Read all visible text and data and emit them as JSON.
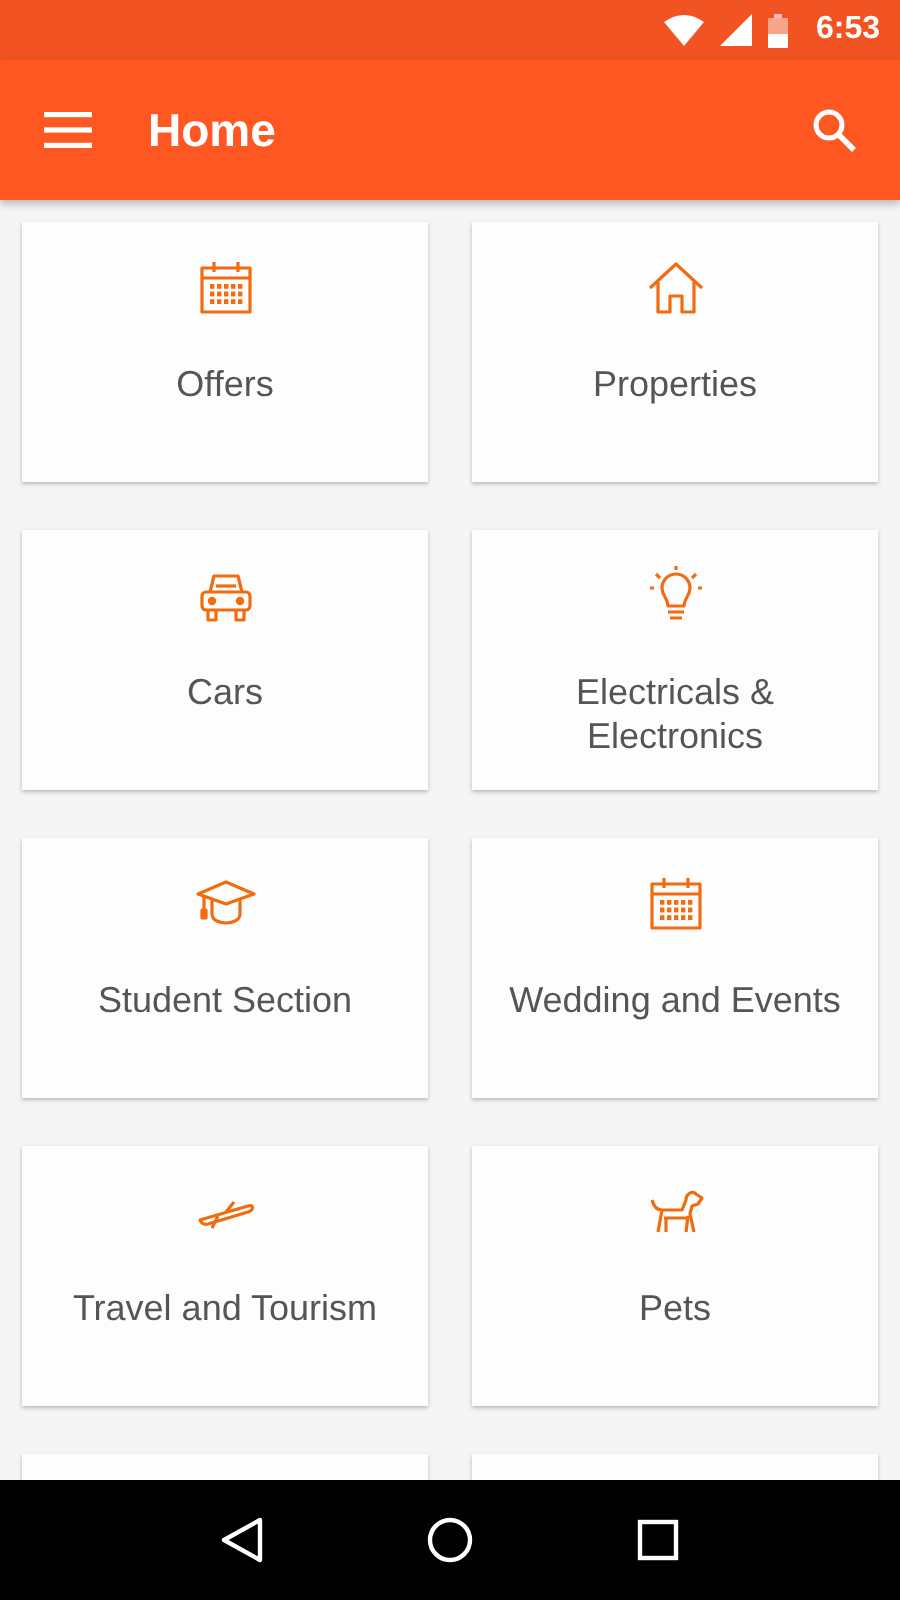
{
  "status_bar": {
    "time": "6:53"
  },
  "toolbar": {
    "title": "Home"
  },
  "categories": [
    {
      "label": "Offers",
      "kind": "calendar"
    },
    {
      "label": "Properties",
      "kind": "house"
    },
    {
      "label": "Cars",
      "kind": "car"
    },
    {
      "label": "Electricals & Electronics",
      "kind": "bulb"
    },
    {
      "label": "Student Section",
      "kind": "cap"
    },
    {
      "label": "Wedding and Events",
      "kind": "calendar"
    },
    {
      "label": "Travel and Tourism",
      "kind": "plane"
    },
    {
      "label": "Pets",
      "kind": "dog"
    },
    {
      "kind": "cut_off"
    },
    {
      "kind": "cut_off"
    }
  ]
}
